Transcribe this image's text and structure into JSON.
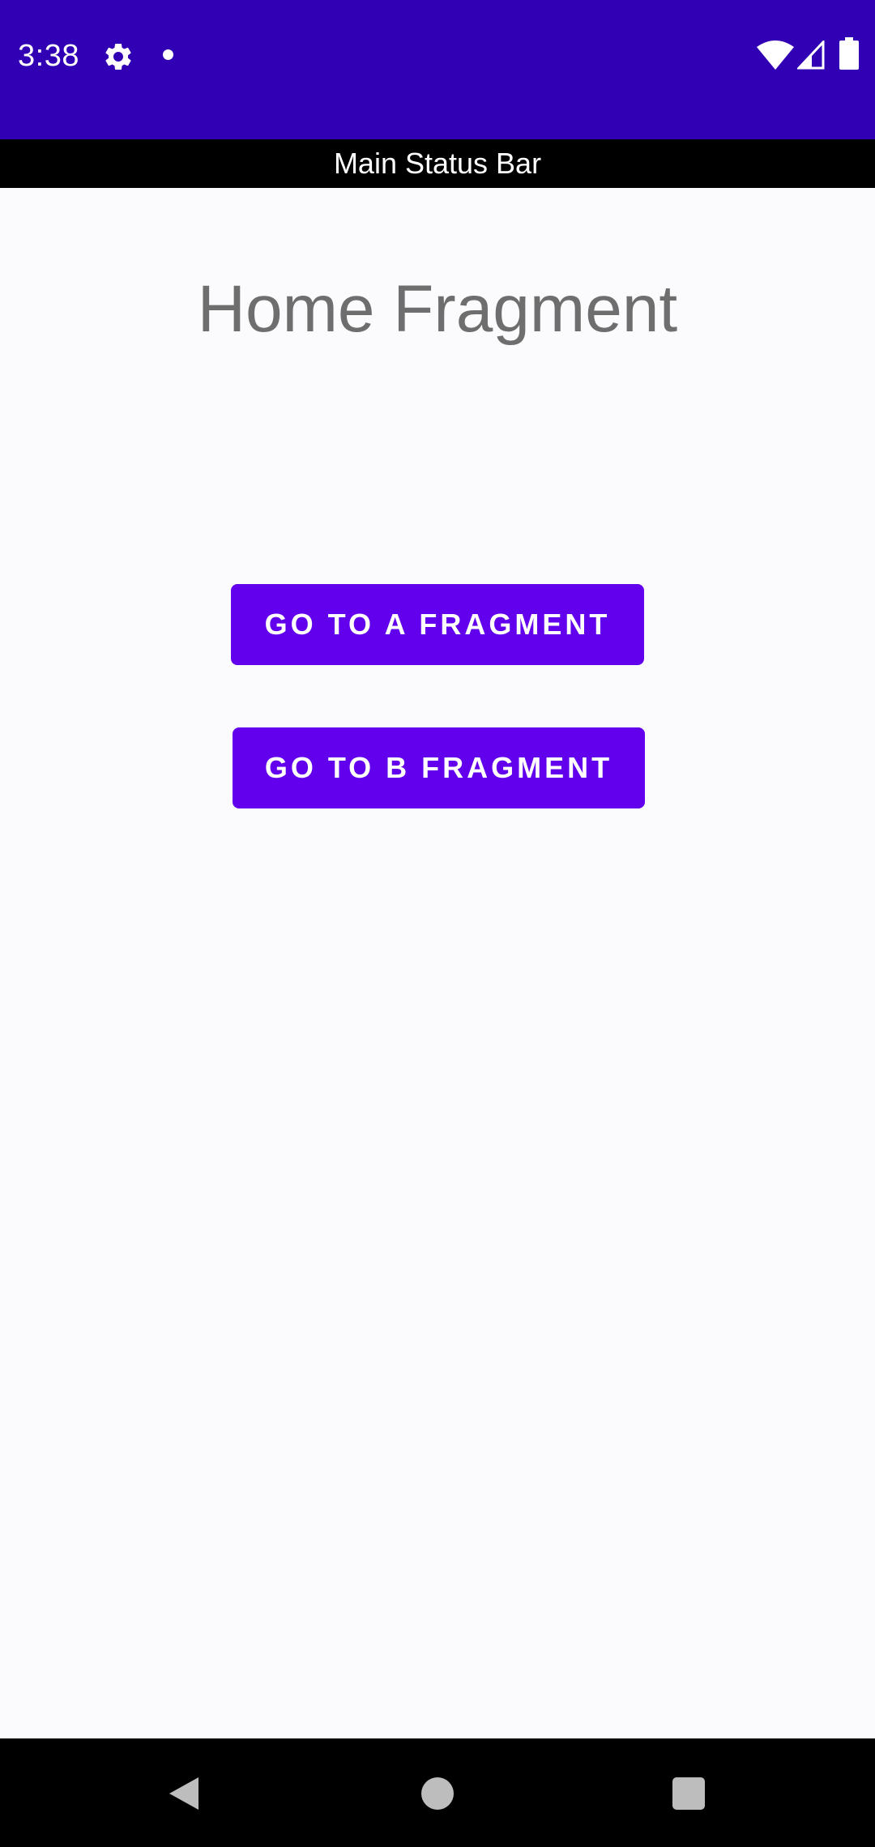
{
  "system_status_bar": {
    "time": "3:38",
    "icons": [
      "gear-icon",
      "notification-dot-icon",
      "wifi-icon",
      "cell-signal-icon",
      "battery-icon"
    ],
    "background": "#3200B4"
  },
  "app_status_bar": {
    "label": "Main Status Bar",
    "background": "#000000"
  },
  "fragment": {
    "title": "Home Fragment",
    "buttons": [
      {
        "label": "GO TO A FRAGMENT"
      },
      {
        "label": "GO TO B FRAGMENT"
      }
    ],
    "button_color": "#6200EE"
  },
  "navigation_bar": {
    "icons": [
      "back-icon",
      "home-icon",
      "recents-icon"
    ]
  }
}
